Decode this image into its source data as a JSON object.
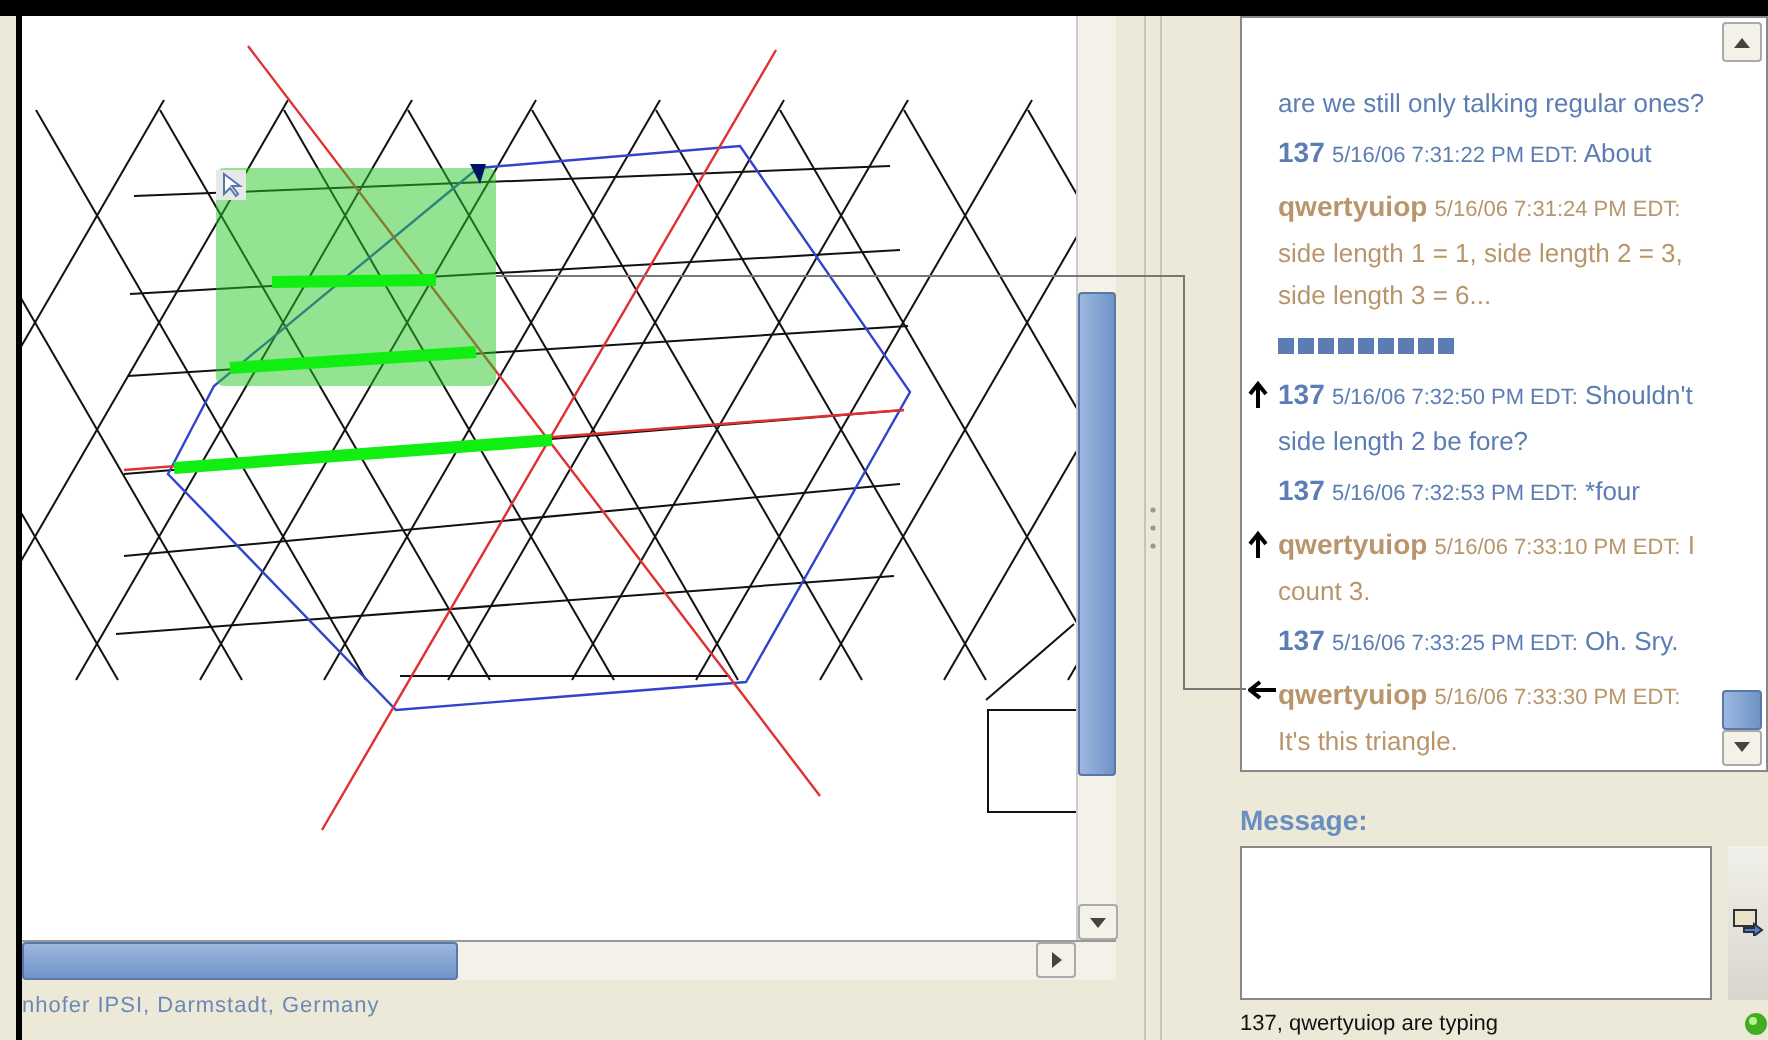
{
  "status_text": "nhofer IPSI, Darmstadt, Germany",
  "chat": {
    "messages": [
      {
        "kind": "text",
        "text": "are we still only talking regular ones?",
        "color": "#5b7db3",
        "arrow_up": false,
        "arrow_left": false
      },
      {
        "kind": "text",
        "author": "137",
        "time": "5/16/06 7:31:22 PM EDT:",
        "text": "About",
        "color": "#5b7db3",
        "arrow_up": false,
        "arrow_left": false
      },
      {
        "kind": "text",
        "author": "qwertyuiop",
        "time": "5/16/06 7:31:24 PM EDT:",
        "text": "side length 1 = 1, side length 2 = 3, side length 3 = 6...",
        "color": "#b8956a",
        "arrow_up": false,
        "arrow_left": false
      },
      {
        "kind": "squares",
        "color": "#5b7db3",
        "arrow_up": false,
        "arrow_left": false
      },
      {
        "kind": "text",
        "author": "137",
        "time": "5/16/06 7:32:50 PM EDT:",
        "text": "Shouldn't side length 2 be fore?",
        "color": "#5b7db3",
        "arrow_up": true,
        "arrow_left": false
      },
      {
        "kind": "text",
        "author": "137",
        "time": "5/16/06 7:32:53 PM EDT:",
        "text": "*four",
        "color": "#5b7db3",
        "arrow_up": false,
        "arrow_left": false
      },
      {
        "kind": "text",
        "author": "qwertyuiop",
        "time": "5/16/06 7:33:10 PM EDT:",
        "text": "I count 3.",
        "color": "#b8956a",
        "arrow_up": true,
        "arrow_left": false
      },
      {
        "kind": "text",
        "author": "137",
        "time": "5/16/06 7:33:25 PM EDT:",
        "text": "Oh. Sry.",
        "color": "#5b7db3",
        "arrow_up": false,
        "arrow_left": false
      },
      {
        "kind": "text",
        "author": "qwertyuiop",
        "time": "5/16/06 7:33:30 PM EDT:",
        "text": "It's this triangle.",
        "color": "#b8956a",
        "arrow_up": false,
        "arrow_left": true
      }
    ]
  },
  "message_label": "Message:",
  "typing_status": "137, qwertyuiop are typing",
  "connected": true
}
